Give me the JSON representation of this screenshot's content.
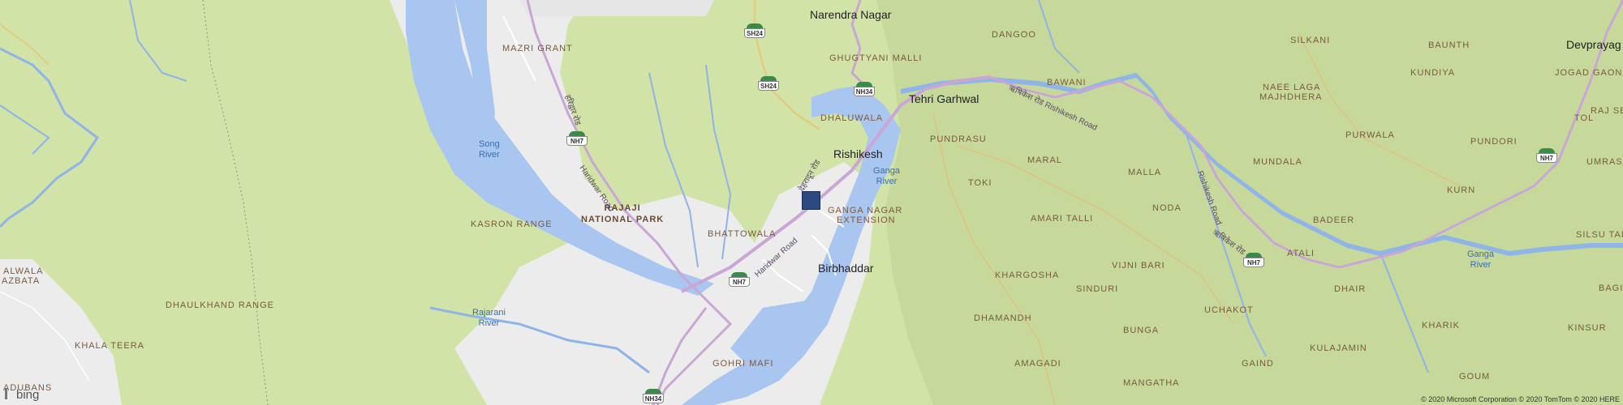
{
  "map": {
    "towns": [
      {
        "id": "narendra-nagar",
        "text": "Narendra Nagar"
      },
      {
        "id": "tehri-garhwal",
        "text": "Tehri Garhwal"
      },
      {
        "id": "rishikesh",
        "text": "Rishikesh"
      },
      {
        "id": "birbhaddar",
        "text": "Birbhaddar"
      },
      {
        "id": "devprayag",
        "text": "Devprayag"
      }
    ],
    "places": [
      {
        "id": "mazri-grant",
        "text": "MAZRI GRANT"
      },
      {
        "id": "ghugtyani-malli",
        "text": "GHUGTYANI MALLI"
      },
      {
        "id": "dhaluwala",
        "text": "DHALUWALA"
      },
      {
        "id": "dangoo",
        "text": "DANGOO"
      },
      {
        "id": "bawani",
        "text": "BAWANI"
      },
      {
        "id": "silkani",
        "text": "SILKANI"
      },
      {
        "id": "baunth",
        "text": "BAUNTH"
      },
      {
        "id": "jogad-gaon",
        "text": "JOGAD GAON"
      },
      {
        "id": "kundiya",
        "text": "KUNDIYA"
      },
      {
        "id": "naee-laga-1",
        "text": "NAEE LAGA"
      },
      {
        "id": "naee-laga-2",
        "text": "MAJHDHERA"
      },
      {
        "id": "raj-se",
        "text": "RAJ SE"
      },
      {
        "id": "tol",
        "text": "TOL"
      },
      {
        "id": "pundrasu",
        "text": "PUNDRASU"
      },
      {
        "id": "maral",
        "text": "MARAL"
      },
      {
        "id": "purwala",
        "text": "PURWALA"
      },
      {
        "id": "pundori",
        "text": "PUNDORI"
      },
      {
        "id": "mundala",
        "text": "MUNDALA"
      },
      {
        "id": "umrasu",
        "text": "UMRASU"
      },
      {
        "id": "malla",
        "text": "MALLA"
      },
      {
        "id": "toki",
        "text": "TOKI"
      },
      {
        "id": "kurn",
        "text": "KURN"
      },
      {
        "id": "noda",
        "text": "NODA"
      },
      {
        "id": "amari-talli",
        "text": "AMARI TALLI"
      },
      {
        "id": "badeer",
        "text": "BADEER"
      },
      {
        "id": "silsu-tal",
        "text": "SILSU TAL"
      },
      {
        "id": "ganga-nagar",
        "text": "GANGA NAGAR"
      },
      {
        "id": "extension",
        "text": "EXTENSION"
      },
      {
        "id": "kasron-range",
        "text": "KASRON RANGE"
      },
      {
        "id": "bhattowala",
        "text": "BHATTOWALA"
      },
      {
        "id": "atali",
        "text": "ATALI"
      },
      {
        "id": "vijni-bari",
        "text": "VIJNI BARI"
      },
      {
        "id": "khargosha",
        "text": "KHARGOSHA"
      },
      {
        "id": "sinduri",
        "text": "SINDURI"
      },
      {
        "id": "alwala",
        "text": "ALWALA"
      },
      {
        "id": "azbata",
        "text": "AZBATA"
      },
      {
        "id": "dhaulkhand-range",
        "text": "DHAULKHAND RANGE"
      },
      {
        "id": "bagi",
        "text": "BAGI"
      },
      {
        "id": "dhair",
        "text": "DHAIR"
      },
      {
        "id": "uchakot",
        "text": "UCHAKOT"
      },
      {
        "id": "dhamandh",
        "text": "DHAMANDH"
      },
      {
        "id": "bunga",
        "text": "BUNGA"
      },
      {
        "id": "kharik",
        "text": "KHARIK"
      },
      {
        "id": "kinsur",
        "text": "KINSUR"
      },
      {
        "id": "kulajamin",
        "text": "KULAJAMIN"
      },
      {
        "id": "khala-teera",
        "text": "KHALA TEERA"
      },
      {
        "id": "gohri-mafi",
        "text": "GOHRI MAFI"
      },
      {
        "id": "amagadi",
        "text": "AMAGADI"
      },
      {
        "id": "gaind",
        "text": "GAIND"
      },
      {
        "id": "goum",
        "text": "GOUM"
      },
      {
        "id": "adubans",
        "text": "ADUBANS"
      },
      {
        "id": "mangatha",
        "text": "MANGATHA"
      }
    ],
    "park": {
      "line1": "RAJAJI",
      "line2": "NATIONAL PARK"
    },
    "water": {
      "song": {
        "line1": "Song",
        "line2": "River"
      },
      "ganga1": {
        "line1": "Ganga",
        "line2": "River"
      },
      "ganga2": {
        "line1": "Ganga",
        "line2": "River"
      },
      "rajarani": {
        "line1": "Rajarani",
        "line2": "River"
      }
    },
    "roads": {
      "haridwar_road": "Haridwar Road",
      "haridwar_road_hindi": "हरिद्वार रोड",
      "rishikesh_road_1": "ऋषिकेश रोड Rishikesh Road",
      "rishikesh_road_2": "Rishikesh Road",
      "rishikesh_road_hindi": "ऋषिकेश रोड",
      "dehradun_road_hindi": "देहरादून रोड"
    },
    "shields": [
      {
        "id": "sh24-a",
        "text": "SH24"
      },
      {
        "id": "sh24-b",
        "text": "SH24"
      },
      {
        "id": "nh34-a",
        "text": "NH34"
      },
      {
        "id": "nh7-a",
        "text": "NH7"
      },
      {
        "id": "nh7-b",
        "text": "NH7"
      },
      {
        "id": "nh7-c",
        "text": "NH7"
      },
      {
        "id": "nh7-d",
        "text": "NH7"
      },
      {
        "id": "nh34-b",
        "text": "NH34"
      }
    ],
    "colors": {
      "land": "#d2e3a7",
      "urban": "#ececec",
      "water": "#a9c6f0",
      "road": "#c9a6d6",
      "pin": "#2d4a80"
    }
  },
  "footer": {
    "bing_logo": "bing",
    "copyright": "© 2020 Microsoft Corporation © 2020 TomTom © 2020 HERE"
  }
}
